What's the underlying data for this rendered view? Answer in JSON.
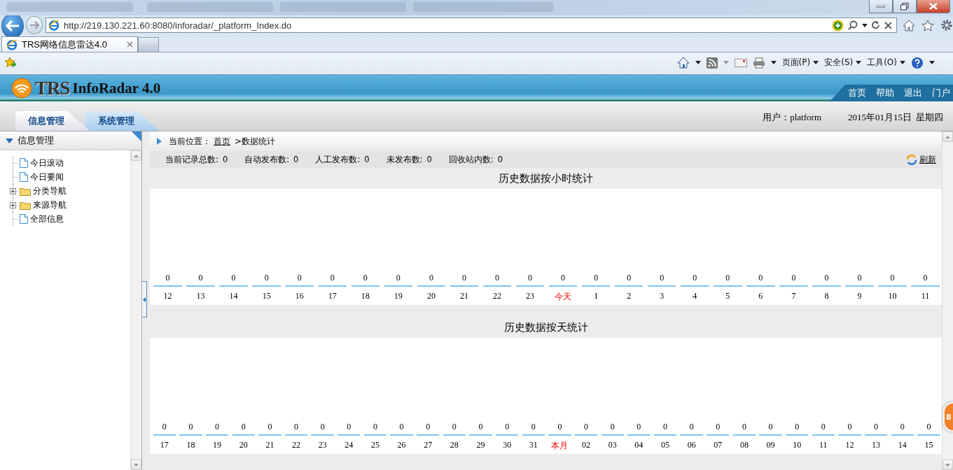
{
  "browser": {
    "address": "http://219.130.221.60:8080/inforadar/_platform_Index.do",
    "tab_title": "TRS网络信息雷达4.0",
    "command_menus": [
      "页面(P)",
      "安全(S)",
      "工具(O)"
    ]
  },
  "app": {
    "logo": "TRS",
    "product": "InfoRadar 4.0",
    "top_links": [
      "首页",
      "帮助",
      "退出",
      "门户"
    ],
    "tabs": [
      {
        "label": "信息管理",
        "selected": true
      },
      {
        "label": "系统管理",
        "selected": false
      }
    ],
    "user_label": "用户：platform",
    "date": "2015年01月15日",
    "weekday": "星期四"
  },
  "sidebar": {
    "title": "信息管理",
    "items": [
      {
        "label": "今日滚动",
        "kind": "page"
      },
      {
        "label": "今日要闻",
        "kind": "page"
      },
      {
        "label": "分类导航",
        "kind": "folder",
        "expanded": false
      },
      {
        "label": "来源导航",
        "kind": "folder",
        "expanded": false
      },
      {
        "label": "全部信息",
        "kind": "page"
      }
    ]
  },
  "breadcrumb": {
    "label": "当前位置：",
    "home_link": "首页",
    "current": ">数据统计"
  },
  "stats": [
    {
      "label": "当前记录总数:",
      "value": "0"
    },
    {
      "label": "自动发布数:",
      "value": "0"
    },
    {
      "label": "人工发布数:",
      "value": "0"
    },
    {
      "label": "未发布数:",
      "value": "0"
    },
    {
      "label": "回收站内数:",
      "value": "0"
    }
  ],
  "refresh": "刷新",
  "charts": [
    {
      "title": "历史数据按小时统计",
      "columns": [
        {
          "count": "0",
          "label": "12",
          "current": false
        },
        {
          "count": "0",
          "label": "13",
          "current": false
        },
        {
          "count": "0",
          "label": "14",
          "current": false
        },
        {
          "count": "0",
          "label": "15",
          "current": false
        },
        {
          "count": "0",
          "label": "16",
          "current": false
        },
        {
          "count": "0",
          "label": "17",
          "current": false
        },
        {
          "count": "0",
          "label": "18",
          "current": false
        },
        {
          "count": "0",
          "label": "19",
          "current": false
        },
        {
          "count": "0",
          "label": "20",
          "current": false
        },
        {
          "count": "0",
          "label": "21",
          "current": false
        },
        {
          "count": "0",
          "label": "22",
          "current": false
        },
        {
          "count": "0",
          "label": "23",
          "current": false
        },
        {
          "count": "0",
          "label": "今天",
          "current": true
        },
        {
          "count": "0",
          "label": "1",
          "current": false
        },
        {
          "count": "0",
          "label": "2",
          "current": false
        },
        {
          "count": "0",
          "label": "3",
          "current": false
        },
        {
          "count": "0",
          "label": "4",
          "current": false
        },
        {
          "count": "0",
          "label": "5",
          "current": false
        },
        {
          "count": "0",
          "label": "6",
          "current": false
        },
        {
          "count": "0",
          "label": "7",
          "current": false
        },
        {
          "count": "0",
          "label": "8",
          "current": false
        },
        {
          "count": "0",
          "label": "9",
          "current": false
        },
        {
          "count": "0",
          "label": "10",
          "current": false
        },
        {
          "count": "0",
          "label": "11",
          "current": false
        }
      ]
    },
    {
      "title": "历史数据按天统计",
      "columns": [
        {
          "count": "0",
          "label": "17",
          "current": false
        },
        {
          "count": "0",
          "label": "18",
          "current": false
        },
        {
          "count": "0",
          "label": "19",
          "current": false
        },
        {
          "count": "0",
          "label": "20",
          "current": false
        },
        {
          "count": "0",
          "label": "21",
          "current": false
        },
        {
          "count": "0",
          "label": "22",
          "current": false
        },
        {
          "count": "0",
          "label": "23",
          "current": false
        },
        {
          "count": "0",
          "label": "24",
          "current": false
        },
        {
          "count": "0",
          "label": "25",
          "current": false
        },
        {
          "count": "0",
          "label": "26",
          "current": false
        },
        {
          "count": "0",
          "label": "27",
          "current": false
        },
        {
          "count": "0",
          "label": "28",
          "current": false
        },
        {
          "count": "0",
          "label": "29",
          "current": false
        },
        {
          "count": "0",
          "label": "30",
          "current": false
        },
        {
          "count": "0",
          "label": "31",
          "current": false
        },
        {
          "count": "0",
          "label": "本月",
          "current": true
        },
        {
          "count": "0",
          "label": "02",
          "current": false
        },
        {
          "count": "0",
          "label": "03",
          "current": false
        },
        {
          "count": "0",
          "label": "04",
          "current": false
        },
        {
          "count": "0",
          "label": "05",
          "current": false
        },
        {
          "count": "0",
          "label": "06",
          "current": false
        },
        {
          "count": "0",
          "label": "07",
          "current": false
        },
        {
          "count": "0",
          "label": "08",
          "current": false
        },
        {
          "count": "0",
          "label": "09",
          "current": false
        },
        {
          "count": "0",
          "label": "10",
          "current": false
        },
        {
          "count": "0",
          "label": "11",
          "current": false
        },
        {
          "count": "0",
          "label": "12",
          "current": false
        },
        {
          "count": "0",
          "label": "13",
          "current": false
        },
        {
          "count": "0",
          "label": "14",
          "current": false
        },
        {
          "count": "0",
          "label": "15",
          "current": false
        }
      ]
    }
  ],
  "floating_badge": "8"
}
